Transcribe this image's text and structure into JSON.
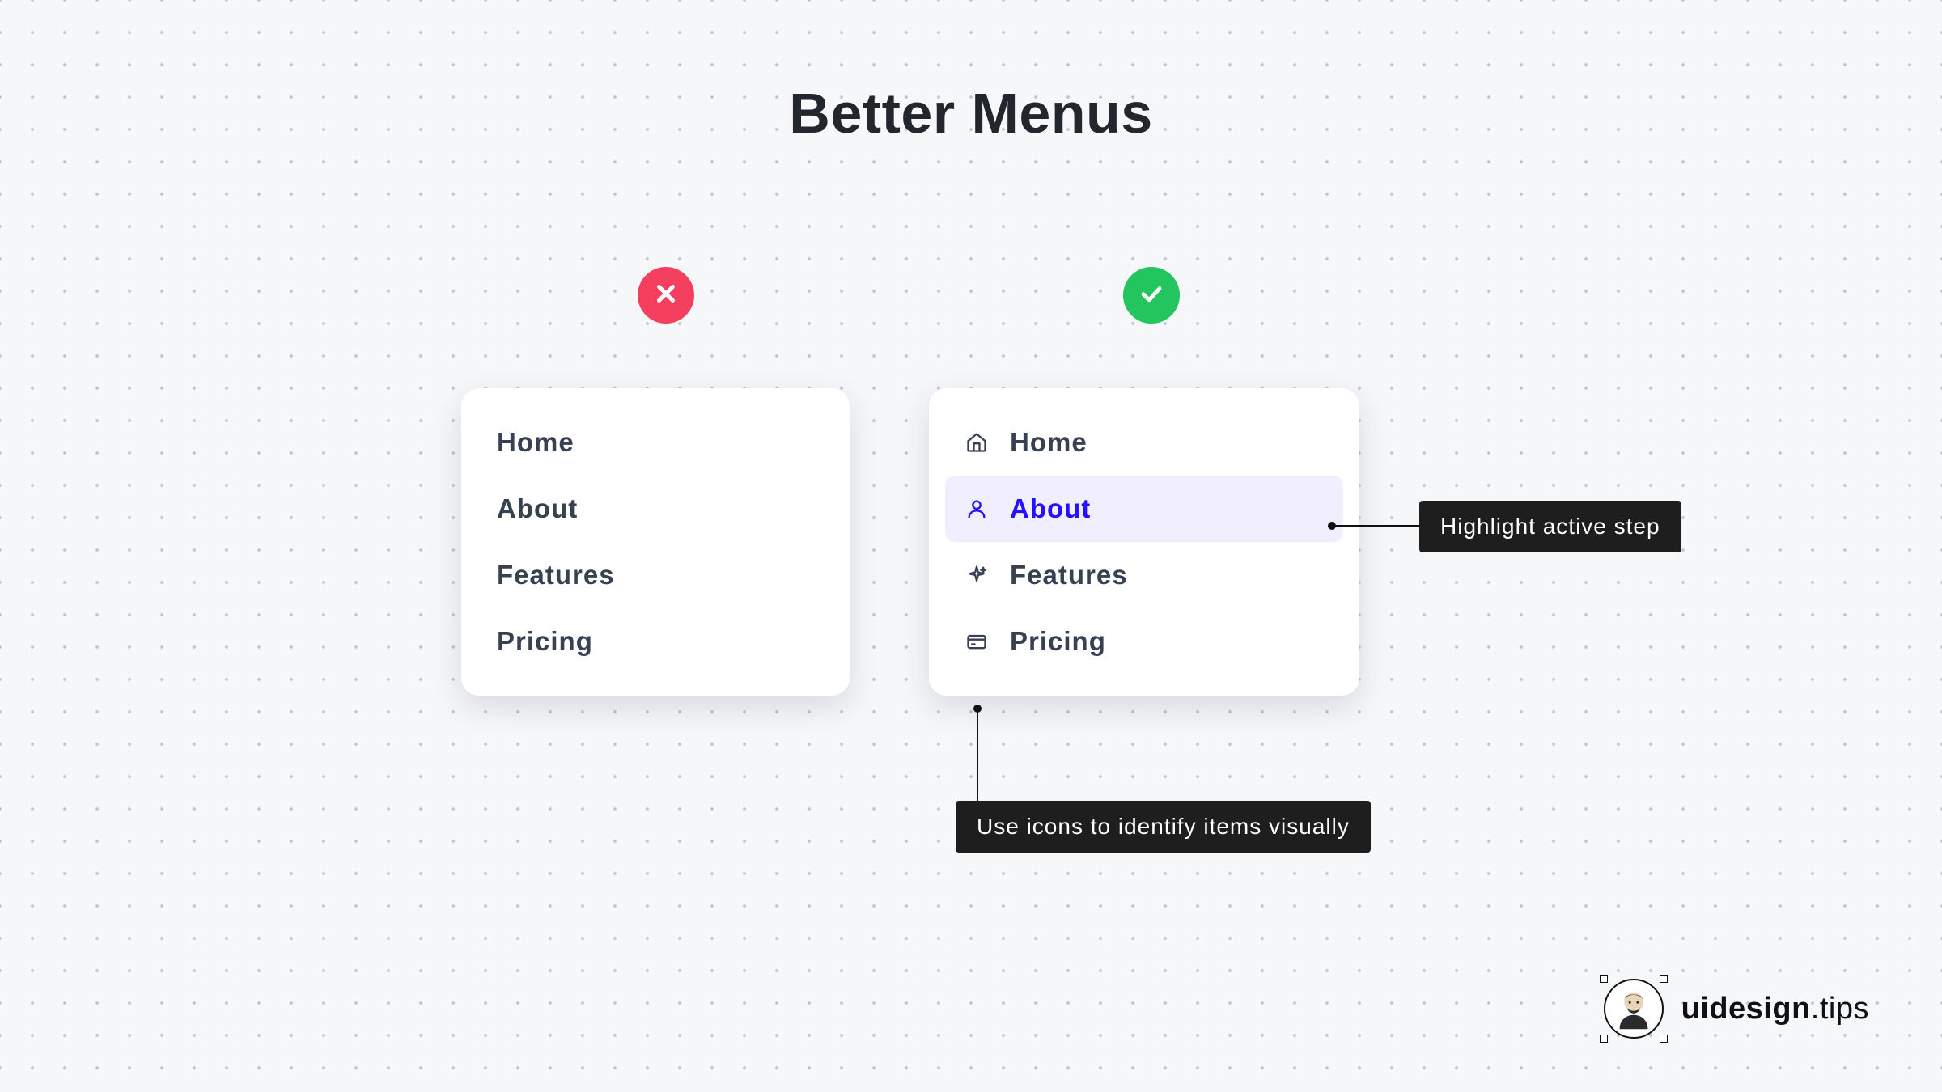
{
  "title": "Better Menus",
  "bad_menu": {
    "items": [
      "Home",
      "About",
      "Features",
      "Pricing"
    ]
  },
  "good_menu": {
    "items": [
      {
        "label": "Home",
        "icon": "home-icon",
        "active": false
      },
      {
        "label": "About",
        "icon": "user-icon",
        "active": true
      },
      {
        "label": "Features",
        "icon": "sparkle-icon",
        "active": false
      },
      {
        "label": "Pricing",
        "icon": "credit-card-icon",
        "active": false
      }
    ]
  },
  "callouts": {
    "highlight": "Highlight active step",
    "icons": "Use icons to identify items visually"
  },
  "credit": {
    "brand_bold": "uidesign",
    "brand_light": ".tips"
  }
}
